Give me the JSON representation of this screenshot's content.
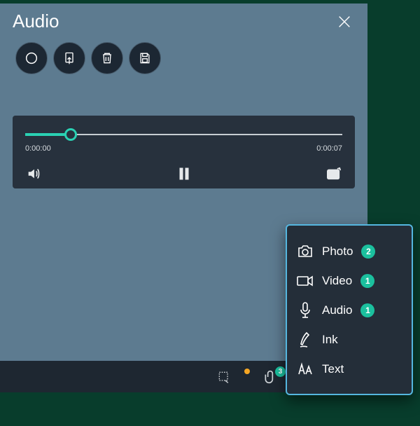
{
  "panel": {
    "title": "Audio",
    "buttons": {
      "record": "record",
      "import": "import",
      "delete": "delete",
      "save": "save"
    }
  },
  "player": {
    "current_time": "0:00:00",
    "total_time": "0:00:07"
  },
  "bottombar": {
    "clip_count": "3"
  },
  "popup": {
    "items": [
      {
        "label": "Photo",
        "count": "2"
      },
      {
        "label": "Video",
        "count": "1"
      },
      {
        "label": "Audio",
        "count": "1"
      },
      {
        "label": "Ink",
        "count": ""
      },
      {
        "label": "Text",
        "count": ""
      }
    ]
  }
}
